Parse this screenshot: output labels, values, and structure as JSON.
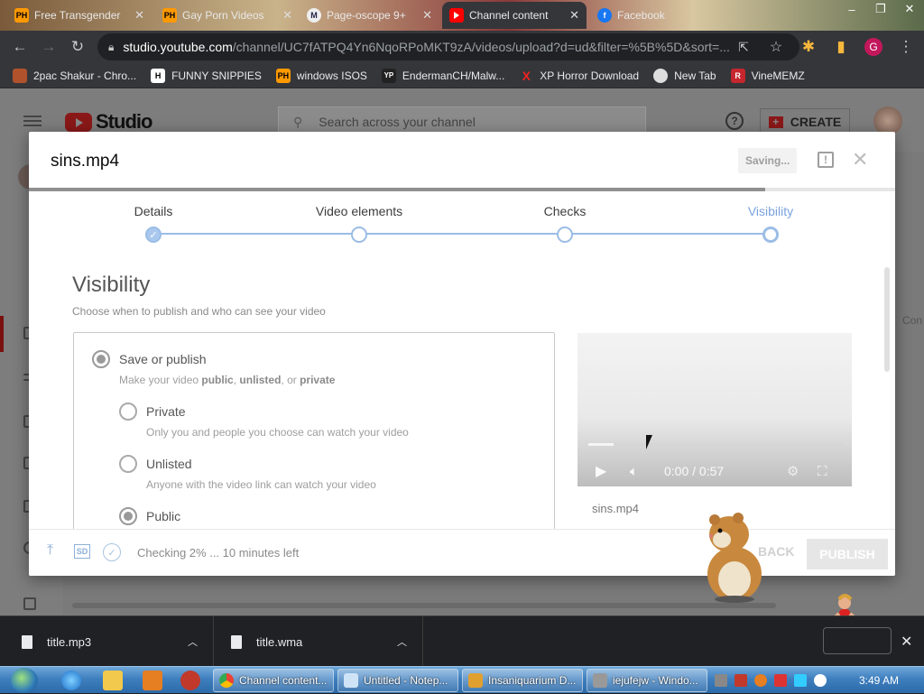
{
  "browser": {
    "tabs": [
      {
        "title": "Free Transgender",
        "favicon": "PH"
      },
      {
        "title": "Gay Porn Videos",
        "favicon": "PH"
      },
      {
        "title": "Page-oscope 9+",
        "favicon": "M"
      },
      {
        "title": "Channel content",
        "favicon": "youtube-icon",
        "active": true
      },
      {
        "title": "Facebook",
        "favicon": "facebook-icon"
      }
    ],
    "url_host": "studio.youtube.com",
    "url_path": "/channel/UC7fATPQ4Yn6NqoRPoMKT9zA/videos/upload?d=ud&filter=%5B%5D&sort=...",
    "profile_initial": "G",
    "bookmarks": [
      {
        "label": "2pac Shakur - Chro...",
        "icon": "page-icon"
      },
      {
        "label": "FUNNY SNIPPIES",
        "icon": "H"
      },
      {
        "label": "windows ISOS",
        "icon": "PH"
      },
      {
        "label": "EndermanCH/Malw...",
        "icon": "YP"
      },
      {
        "label": "XP Horror Download",
        "icon": "X"
      },
      {
        "label": "New Tab",
        "icon": "globe-icon"
      },
      {
        "label": "VineMEMZ",
        "icon": "R"
      }
    ]
  },
  "studio": {
    "logo_text": "Studio",
    "search_placeholder": "Search across your channel",
    "create_label": "CREATE",
    "right_clip_text": "Con"
  },
  "dialog": {
    "title": "sins.mp4",
    "saving_label": "Saving...",
    "upload_progress": 0.85,
    "steps": [
      {
        "label": "Details",
        "state": "done"
      },
      {
        "label": "Video elements",
        "state": "pending"
      },
      {
        "label": "Checks",
        "state": "pending"
      },
      {
        "label": "Visibility",
        "state": "current"
      }
    ],
    "visibility_title": "Visibility",
    "visibility_subtitle": "Choose when to publish and who can see your video",
    "save_publish": {
      "label": "Save or publish",
      "desc_prefix": "Make your video ",
      "desc_public": "public",
      "desc_sep1": ", ",
      "desc_unlisted": "unlisted",
      "desc_sep2": ", or ",
      "desc_private": "private"
    },
    "options": [
      {
        "label": "Private",
        "desc": "Only you and people you choose can watch your video",
        "selected": false
      },
      {
        "label": "Unlisted",
        "desc": "Anyone with the video link can watch your video",
        "selected": false
      },
      {
        "label": "Public",
        "desc": "",
        "selected": true
      }
    ],
    "player": {
      "time": "0:00 / 0:57",
      "played_fraction": 0.1
    },
    "filename_label": "sins.mp4",
    "checking_text": "Checking 2% ... 10 minutes left",
    "sd_label": "SD",
    "back_label": "BACK",
    "publish_label": "PUBLISH"
  },
  "downloads": [
    {
      "name": "title.mp3"
    },
    {
      "name": "title.wma"
    }
  ],
  "taskbar": {
    "tasks": [
      {
        "label": "Channel content..."
      },
      {
        "label": "Untitled - Notep..."
      },
      {
        "label": "Insaniquarium D..."
      },
      {
        "label": "iejufejw - Windo..."
      }
    ],
    "clock": "3:49 AM"
  }
}
